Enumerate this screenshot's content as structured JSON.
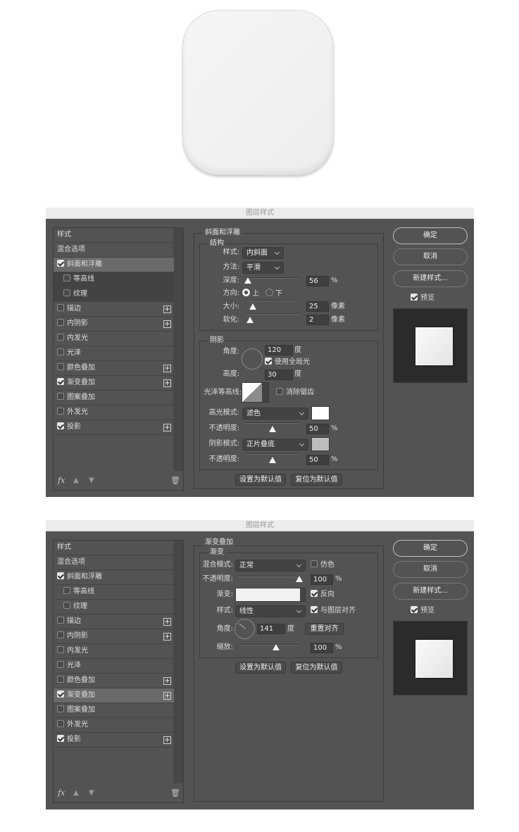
{
  "dialog_title": "图层样式",
  "left_list": [
    {
      "label": "样式",
      "checkbox": false
    },
    {
      "label": "混合选项",
      "checkbox": false
    },
    {
      "label": "斜面和浮雕",
      "checkbox": true,
      "checked": true
    },
    {
      "label": "等高线",
      "checkbox": true,
      "checked": false,
      "sub": true
    },
    {
      "label": "纹理",
      "checkbox": true,
      "checked": false,
      "sub": true
    },
    {
      "label": "描边",
      "checkbox": true,
      "checked": false,
      "plus": true
    },
    {
      "label": "内阴影",
      "checkbox": true,
      "checked": false,
      "plus": true
    },
    {
      "label": "内发光",
      "checkbox": true,
      "checked": false
    },
    {
      "label": "光泽",
      "checkbox": true,
      "checked": false
    },
    {
      "label": "颜色叠加",
      "checkbox": true,
      "checked": false,
      "plus": true
    },
    {
      "label": "渐变叠加",
      "checkbox": true,
      "checked": true,
      "plus": true
    },
    {
      "label": "图案叠加",
      "checkbox": true,
      "checked": false
    },
    {
      "label": "外发光",
      "checkbox": true,
      "checked": false
    },
    {
      "label": "投影",
      "checkbox": true,
      "checked": true,
      "plus": true
    }
  ],
  "footer": {
    "fx": "fx",
    "up_icon": "arrow-up-icon",
    "down_icon": "arrow-down-icon",
    "trash_icon": "trash-icon"
  },
  "right": {
    "ok": "确定",
    "cancel": "取消",
    "new_style": "新建样式...",
    "preview": "预览",
    "preview_checked": true
  },
  "bottom_buttons": {
    "set_default": "设置为默认值",
    "reset_default": "复位为默认值"
  },
  "bevel": {
    "title": "斜面和浮雕",
    "structure": {
      "title": "结构",
      "style_label": "样式:",
      "style_value": "内斜面",
      "technique_label": "方法:",
      "technique_value": "平滑",
      "depth_label": "深度:",
      "depth_value": "56",
      "depth_unit": "%",
      "direction_label": "方向:",
      "dir_up": "上",
      "dir_down": "下",
      "direction_selected": "上",
      "size_label": "大小:",
      "size_value": "25",
      "size_unit": "像素",
      "soften_label": "软化:",
      "soften_value": "2",
      "soften_unit": "像素"
    },
    "shading": {
      "title": "阴影",
      "angle_label": "角度:",
      "angle_value": "120",
      "angle_unit": "度",
      "global_light": "使用全局光",
      "global_light_checked": true,
      "altitude_label": "高度:",
      "altitude_value": "30",
      "altitude_unit": "度",
      "gloss_label": "光泽等高线:",
      "anti_alias": "消除锯齿",
      "anti_alias_checked": false,
      "highlight_label": "高光模式:",
      "highlight_value": "滤色",
      "highlight_color": "#ffffff",
      "hl_opacity_label": "不透明度:",
      "hl_opacity_value": "50",
      "hl_opacity_unit": "%",
      "shadow_label": "阴影模式:",
      "shadow_value": "正片叠底",
      "shadow_color": "#bdbdbd",
      "sh_opacity_label": "不透明度:",
      "sh_opacity_value": "50",
      "sh_opacity_unit": "%"
    }
  },
  "gradient": {
    "title": "渐变叠加",
    "group": "渐变",
    "blend_label": "混合模式:",
    "blend_value": "正常",
    "dither": "仿色",
    "dither_checked": false,
    "opacity_label": "不透明度:",
    "opacity_value": "100",
    "opacity_unit": "%",
    "gradient_label": "渐变:",
    "gradient_color": "#f2f2f2",
    "reverse": "反向",
    "reverse_checked": true,
    "style_label": "样式:",
    "style_value": "线性",
    "align": "与图层对齐",
    "align_checked": true,
    "angle_label": "角度:",
    "angle_value": "141",
    "angle_unit": "度",
    "reset_align": "重置对齐",
    "scale_label": "缩放:",
    "scale_value": "100",
    "scale_unit": "%"
  }
}
